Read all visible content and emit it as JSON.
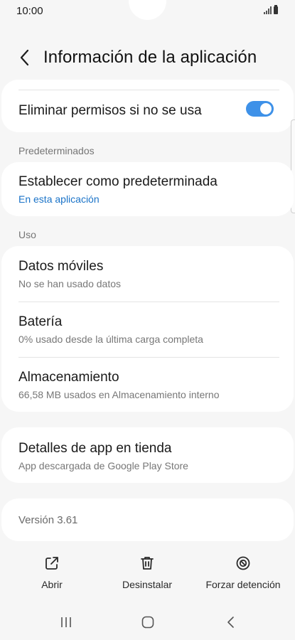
{
  "status_bar": {
    "time": "10:00"
  },
  "header": {
    "title": "Información de la aplicación"
  },
  "permissions_card": {
    "remove_permissions_label": "Eliminar permisos si no se usa",
    "toggle_on": true
  },
  "defaults_section": {
    "label": "Predeterminados",
    "set_default_title": "Establecer como predeterminada",
    "set_default_sub": "En esta aplicación"
  },
  "usage_section": {
    "label": "Uso",
    "items": [
      {
        "title": "Datos móviles",
        "sub": "No se han usado datos"
      },
      {
        "title": "Batería",
        "sub": "0% usado desde la última carga completa"
      },
      {
        "title": "Almacenamiento",
        "sub": "66,58 MB usados en Almacenamiento interno"
      }
    ]
  },
  "store_card": {
    "title": "Detalles de app en tienda",
    "sub": "App descargada de Google Play Store"
  },
  "version_card": {
    "text": "Versión 3.61"
  },
  "bottom_actions": {
    "open": "Abrir",
    "uninstall": "Desinstalar",
    "force_stop": "Forzar detención"
  },
  "colors": {
    "accent": "#3e91e8",
    "link": "#1a73c8",
    "background": "#f6f6f6",
    "card": "#ffffff"
  }
}
